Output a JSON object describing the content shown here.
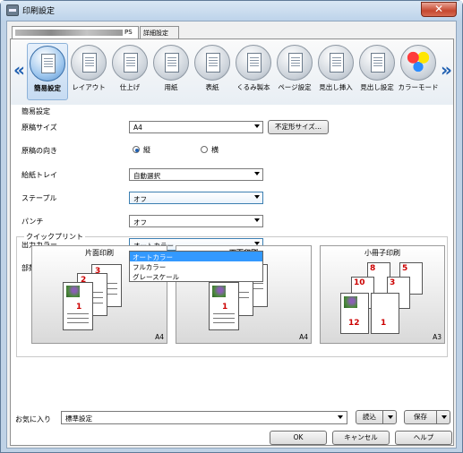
{
  "window": {
    "title": "印刷設定",
    "close_glyph": "✕"
  },
  "tabs": [
    {
      "label": "PS"
    },
    {
      "label": "詳細設定"
    }
  ],
  "nav": {
    "left_arrow": "«",
    "right_arrow": "»"
  },
  "iconbar": [
    {
      "label": "簡易設定"
    },
    {
      "label": "レイアウト"
    },
    {
      "label": "仕上げ"
    },
    {
      "label": "用紙"
    },
    {
      "label": "表紙"
    },
    {
      "label": "くるみ製本"
    },
    {
      "label": "ページ設定"
    },
    {
      "label": "見出し挿入"
    },
    {
      "label": "見出し設定"
    },
    {
      "label": "カラーモード"
    }
  ],
  "settings": {
    "group_title": "簡易設定",
    "paper_size": {
      "label": "原稿サイズ",
      "value": "A4",
      "button": "不定形サイズ..."
    },
    "orientation": {
      "label": "原稿の向き",
      "portrait": "縦",
      "landscape": "横"
    },
    "tray": {
      "label": "給紙トレイ",
      "value": "自動選択"
    },
    "staple": {
      "label": "ステープル",
      "value": "オフ"
    },
    "punch": {
      "label": "パンチ",
      "value": "オフ"
    },
    "color": {
      "label": "出力カラー",
      "value": "オートカラー",
      "options": [
        "オートカラー",
        "フルカラー",
        "グレースケール"
      ]
    },
    "copies": {
      "label": "部数"
    }
  },
  "quickprint": {
    "title": "クイックプリント",
    "cards": [
      {
        "name": "片面印刷",
        "size": "A4",
        "pages": [
          "3",
          "2",
          "1"
        ]
      },
      {
        "name": "両面印刷",
        "size": "A4",
        "pages": [
          "5",
          "3",
          "1"
        ]
      },
      {
        "name": "小冊子印刷",
        "size": "A3",
        "pages": [
          "8",
          "5",
          "10",
          "3",
          "12",
          "1"
        ]
      }
    ]
  },
  "bottom": {
    "favorites_label": "お気に入り",
    "favorites_value": "標準設定",
    "load": "読込",
    "save": "保存",
    "ok": "OK",
    "cancel": "キャンセル",
    "help": "ヘルプ"
  }
}
